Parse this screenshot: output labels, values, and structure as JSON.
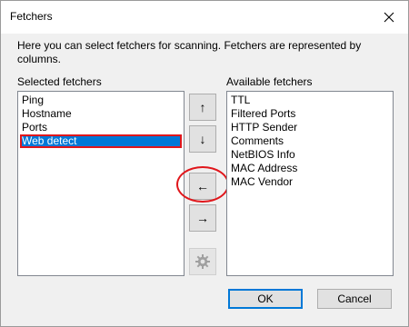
{
  "window": {
    "title": "Fetchers"
  },
  "description": "Here you can select fetchers for scanning. Fetchers are represented by columns.",
  "selected": {
    "label": "Selected fetchers",
    "items": [
      "Ping",
      "Hostname",
      "Ports",
      "Web detect"
    ],
    "selected_item": "Web detect"
  },
  "available": {
    "label": "Available fetchers",
    "items": [
      "TTL",
      "Filtered Ports",
      "HTTP Sender",
      "Comments",
      "NetBIOS Info",
      "MAC Address",
      "MAC Vendor"
    ]
  },
  "controls": {
    "up": "↑",
    "down": "↓",
    "remove": "←",
    "add": "→"
  },
  "buttons": {
    "ok": "OK",
    "cancel": "Cancel"
  },
  "colors": {
    "selection": "#0078d7",
    "annotation": "#e0161b"
  }
}
